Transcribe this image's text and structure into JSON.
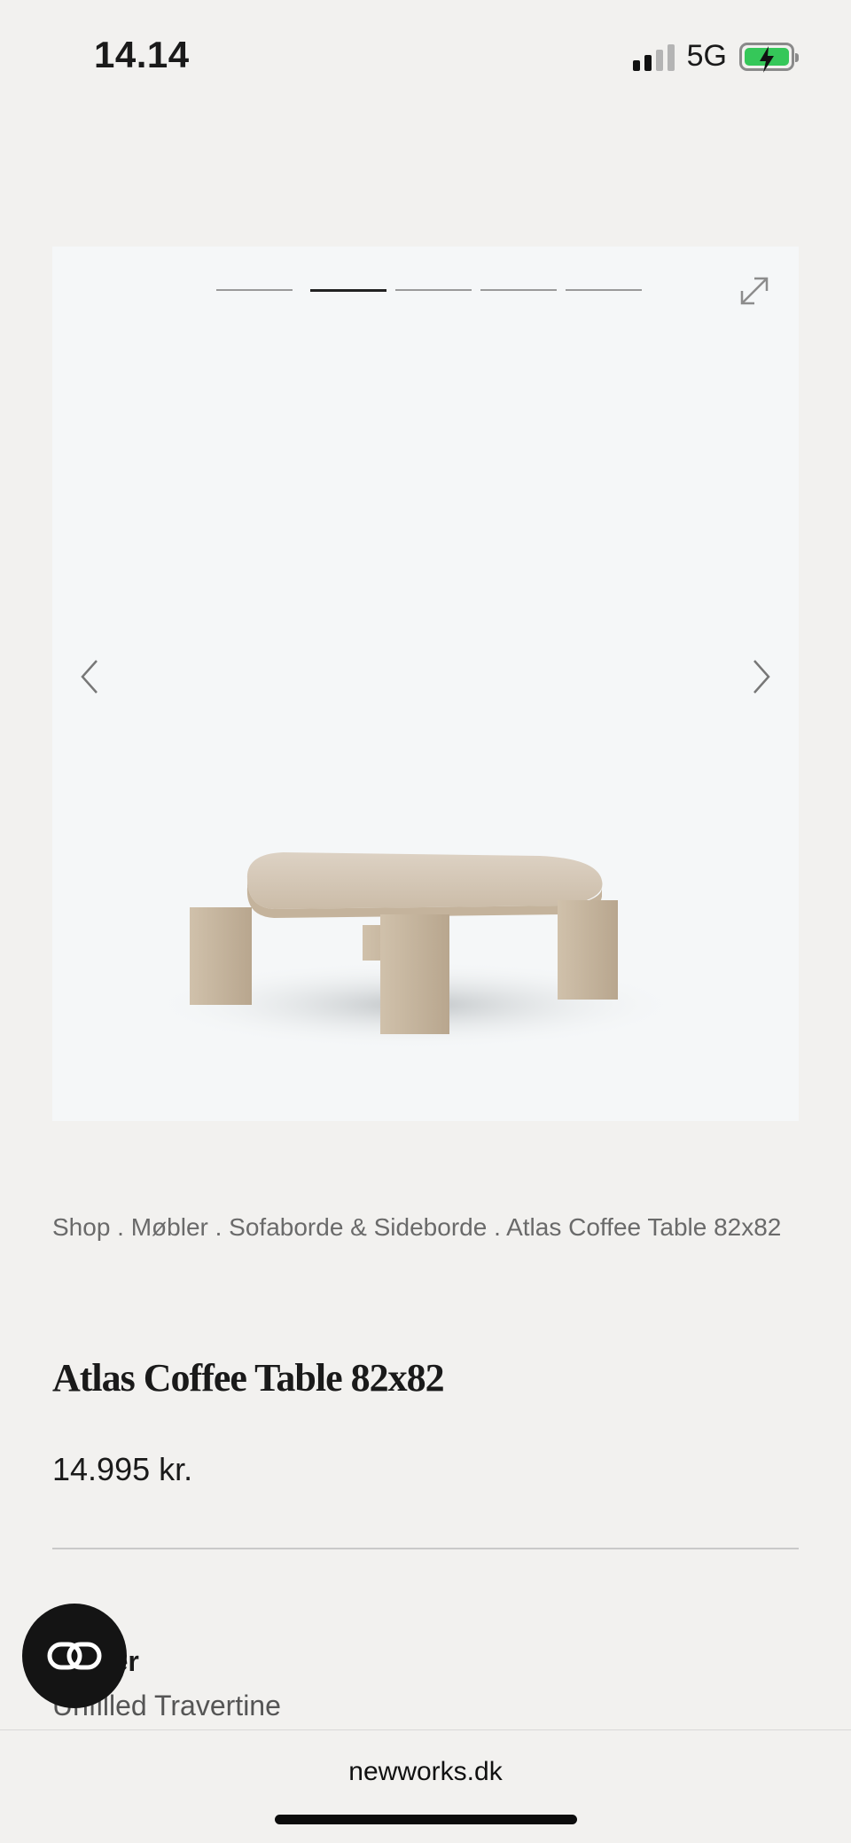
{
  "status_bar": {
    "time": "14.14",
    "network": "5G",
    "battery_icon": "battery-charging-icon",
    "signal_icon": "signal-icon"
  },
  "gallery": {
    "slide_count": 5,
    "active_slide": 2,
    "expand_icon": "expand-icon",
    "prev_icon": "chevron-left-icon",
    "next_icon": "chevron-right-icon",
    "background": "#f5f7f8"
  },
  "breadcrumb": {
    "text": "Shop . Møbler . Sofaborde & Sideborde . Atlas Coffee Table 82x82"
  },
  "product": {
    "title": "Atlas Coffee Table 82x82",
    "price": "14.995 kr."
  },
  "variant": {
    "label": "Variant",
    "label_visible": "nter",
    "value": "Unfilled Travertine"
  },
  "floating_button": {
    "icon": "link-icon"
  },
  "browser": {
    "url": "newworks.dk"
  },
  "colors": {
    "page_background": "#f2f1ef",
    "text_primary": "#1a1a1a",
    "battery_green": "#35c759"
  }
}
